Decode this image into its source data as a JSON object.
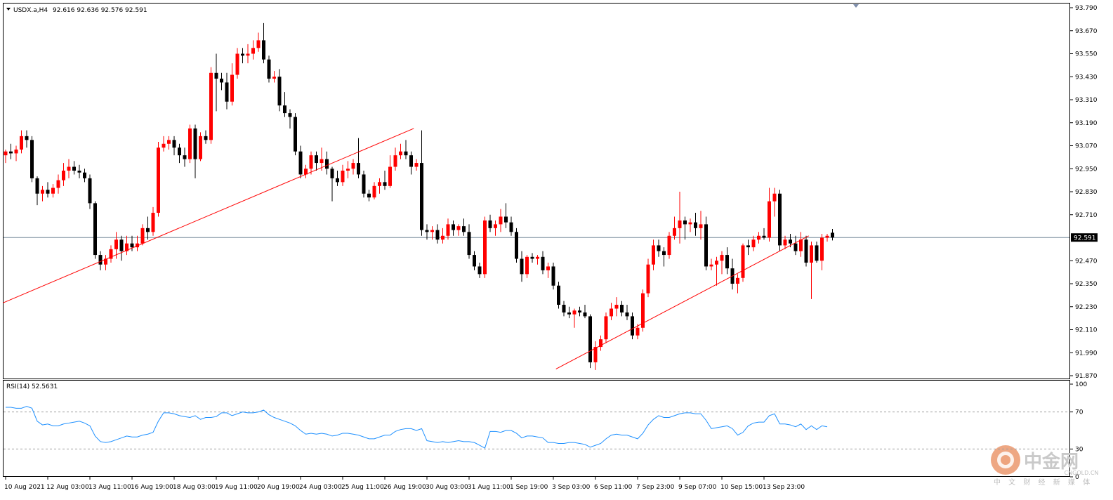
{
  "header": {
    "symbol": "USDX.a,H4",
    "ohlc": "92.616 92.636 92.576 92.591"
  },
  "rsi_header": "RSI(14) 52.5631",
  "current_price_label": "92.591",
  "watermark": {
    "brand": "中金网",
    "domain": "CNGOLD.CN",
    "tagline": "中 文 财 经 新 媒 体"
  },
  "colors": {
    "bull": "#ff0000",
    "bear": "#000000",
    "trendline": "#ff0000",
    "rsi": "#1e90ff",
    "price_line": "#778899",
    "level_line": "#a0a0a0"
  },
  "chart_data": [
    {
      "type": "candlestick",
      "ylim": [
        91.87,
        93.79
      ],
      "yticks": [
        93.79,
        93.67,
        93.55,
        93.43,
        93.31,
        93.19,
        93.07,
        92.95,
        92.83,
        92.71,
        92.47,
        92.35,
        92.23,
        92.11,
        91.99,
        91.87
      ],
      "ytick_labels": [
        "93.790",
        "93.670",
        "93.550",
        "93.430",
        "93.310",
        "93.190",
        "93.070",
        "92.950",
        "92.830",
        "92.710",
        "92.470",
        "92.350",
        "92.230",
        "92.110",
        "91.990",
        "91.870"
      ],
      "xtick_labels": [
        "10 Aug 2021",
        "12 Aug 03:00",
        "13 Aug 11:00",
        "16 Aug 19:00",
        "18 Aug 03:00",
        "19 Aug 11:00",
        "20 Aug 19:00",
        "24 Aug 03:00",
        "25 Aug 11:00",
        "26 Aug 19:00",
        "30 Aug 03:00",
        "31 Aug 11:00",
        "1 Sep 19:00",
        "3 Sep 03:00",
        "6 Sep 11:00",
        "7 Sep 23:00",
        "9 Sep 07:00",
        "10 Sep 15:00",
        "13 Sep 23:00"
      ],
      "xtick_index": [
        0,
        8,
        16,
        24,
        32,
        40,
        48,
        56,
        64,
        72,
        80,
        88,
        96,
        104,
        112,
        120,
        128,
        136,
        144
      ],
      "current_price": 92.591,
      "ohlc": [
        [
          93.02,
          93.05,
          92.98,
          93.04
        ],
        [
          93.04,
          93.08,
          93.0,
          93.03
        ],
        [
          93.03,
          93.07,
          92.99,
          93.05
        ],
        [
          93.05,
          93.15,
          93.03,
          93.12
        ],
        [
          93.12,
          93.15,
          93.06,
          93.1
        ],
        [
          93.1,
          93.12,
          92.88,
          92.9
        ],
        [
          92.9,
          92.91,
          92.76,
          92.82
        ],
        [
          92.82,
          92.86,
          92.78,
          92.84
        ],
        [
          92.84,
          92.88,
          92.8,
          92.82
        ],
        [
          92.82,
          92.87,
          92.8,
          92.85
        ],
        [
          92.85,
          92.92,
          92.82,
          92.89
        ],
        [
          92.89,
          92.98,
          92.86,
          92.94
        ],
        [
          92.94,
          93.0,
          92.9,
          92.96
        ],
        [
          92.96,
          92.99,
          92.92,
          92.94
        ],
        [
          92.94,
          92.97,
          92.9,
          92.93
        ],
        [
          92.93,
          92.95,
          92.88,
          92.9
        ],
        [
          92.9,
          92.92,
          92.74,
          92.77
        ],
        [
          92.77,
          92.78,
          92.48,
          92.5
        ],
        [
          92.5,
          92.52,
          92.42,
          92.45
        ],
        [
          92.45,
          92.5,
          92.42,
          92.48
        ],
        [
          92.48,
          92.55,
          92.46,
          92.53
        ],
        [
          92.53,
          92.62,
          92.48,
          92.58
        ],
        [
          92.58,
          92.6,
          92.47,
          92.52
        ],
        [
          92.52,
          92.6,
          92.5,
          92.56
        ],
        [
          92.56,
          92.6,
          92.52,
          92.54
        ],
        [
          92.54,
          92.6,
          92.52,
          92.56
        ],
        [
          92.56,
          92.66,
          92.55,
          92.64
        ],
        [
          92.64,
          92.7,
          92.58,
          92.62
        ],
        [
          92.62,
          92.75,
          92.6,
          92.72
        ],
        [
          92.72,
          93.09,
          92.7,
          93.06
        ],
        [
          93.06,
          93.12,
          93.04,
          93.08
        ],
        [
          93.08,
          93.12,
          93.05,
          93.1
        ],
        [
          93.1,
          93.12,
          93.02,
          93.06
        ],
        [
          93.06,
          93.08,
          92.98,
          93.02
        ],
        [
          93.02,
          93.06,
          92.96,
          93.0
        ],
        [
          93.0,
          93.18,
          92.98,
          93.16
        ],
        [
          93.16,
          93.18,
          92.9,
          93.0
        ],
        [
          93.0,
          93.14,
          92.99,
          93.12
        ],
        [
          93.12,
          93.15,
          93.08,
          93.1
        ],
        [
          93.1,
          93.48,
          93.08,
          93.45
        ],
        [
          93.45,
          93.55,
          93.25,
          93.42
        ],
        [
          93.42,
          93.45,
          93.36,
          93.4
        ],
        [
          93.4,
          93.45,
          93.26,
          93.3
        ],
        [
          93.3,
          93.5,
          93.28,
          93.44
        ],
        [
          93.44,
          93.58,
          93.42,
          93.55
        ],
        [
          93.55,
          93.58,
          93.5,
          93.54
        ],
        [
          93.54,
          93.6,
          93.5,
          93.55
        ],
        [
          93.55,
          93.62,
          93.52,
          93.58
        ],
        [
          93.58,
          93.66,
          93.56,
          93.62
        ],
        [
          93.62,
          93.71,
          93.5,
          93.52
        ],
        [
          93.52,
          93.54,
          93.4,
          93.42
        ],
        [
          93.42,
          93.46,
          93.4,
          93.43
        ],
        [
          93.43,
          93.47,
          93.25,
          93.28
        ],
        [
          93.28,
          93.35,
          93.22,
          93.24
        ],
        [
          93.24,
          93.26,
          93.16,
          93.22
        ],
        [
          93.22,
          93.24,
          93.02,
          93.04
        ],
        [
          93.04,
          93.07,
          92.9,
          92.92
        ],
        [
          92.92,
          92.97,
          92.9,
          92.95
        ],
        [
          92.95,
          93.04,
          92.92,
          93.02
        ],
        [
          93.02,
          93.04,
          92.94,
          92.98
        ],
        [
          92.98,
          93.06,
          92.94,
          93.0
        ],
        [
          93.0,
          93.04,
          92.92,
          92.95
        ],
        [
          92.95,
          92.96,
          92.78,
          92.9
        ],
        [
          92.9,
          92.94,
          92.86,
          92.88
        ],
        [
          92.88,
          92.97,
          92.86,
          92.94
        ],
        [
          92.94,
          92.99,
          92.9,
          92.95
        ],
        [
          92.95,
          93.0,
          92.92,
          92.98
        ],
        [
          92.98,
          93.11,
          92.9,
          92.92
        ],
        [
          92.92,
          92.94,
          92.8,
          92.82
        ],
        [
          92.82,
          92.84,
          92.78,
          92.8
        ],
        [
          92.8,
          92.88,
          92.79,
          92.86
        ],
        [
          92.86,
          92.9,
          92.82,
          92.88
        ],
        [
          92.88,
          92.94,
          92.84,
          92.86
        ],
        [
          92.86,
          93.02,
          92.85,
          92.96
        ],
        [
          92.96,
          93.06,
          92.94,
          93.02
        ],
        [
          93.02,
          93.08,
          93.0,
          93.04
        ],
        [
          93.04,
          93.1,
          93.0,
          93.02
        ],
        [
          93.02,
          93.04,
          92.92,
          92.96
        ],
        [
          92.96,
          93.0,
          92.94,
          92.98
        ],
        [
          92.98,
          93.15,
          92.6,
          92.63
        ],
        [
          92.63,
          92.66,
          92.58,
          92.62
        ],
        [
          92.62,
          92.65,
          92.58,
          92.63
        ],
        [
          92.63,
          92.66,
          92.56,
          92.58
        ],
        [
          92.58,
          92.64,
          92.56,
          92.6
        ],
        [
          92.6,
          92.69,
          92.58,
          92.66
        ],
        [
          92.66,
          92.68,
          92.6,
          92.63
        ],
        [
          92.63,
          92.66,
          92.6,
          92.65
        ],
        [
          92.65,
          92.69,
          92.6,
          92.62
        ],
        [
          92.62,
          92.66,
          92.48,
          92.5
        ],
        [
          92.5,
          92.52,
          92.42,
          92.44
        ],
        [
          92.44,
          92.46,
          92.38,
          92.4
        ],
        [
          92.4,
          92.7,
          92.38,
          92.68
        ],
        [
          92.68,
          92.71,
          92.62,
          92.64
        ],
        [
          92.64,
          92.68,
          92.6,
          92.66
        ],
        [
          92.66,
          92.74,
          92.62,
          92.7
        ],
        [
          92.7,
          92.77,
          92.64,
          92.67
        ],
        [
          92.67,
          92.7,
          92.6,
          92.62
        ],
        [
          92.62,
          92.64,
          92.46,
          92.48
        ],
        [
          92.48,
          92.52,
          92.36,
          92.4
        ],
        [
          92.4,
          92.5,
          92.38,
          92.49
        ],
        [
          92.49,
          92.51,
          92.46,
          92.48
        ],
        [
          92.48,
          92.5,
          92.45,
          92.49
        ],
        [
          92.49,
          92.52,
          92.4,
          92.42
        ],
        [
          92.42,
          92.46,
          92.38,
          92.44
        ],
        [
          92.44,
          92.46,
          92.32,
          92.34
        ],
        [
          92.34,
          92.36,
          92.22,
          92.24
        ],
        [
          92.24,
          92.26,
          92.18,
          92.2
        ],
        [
          92.2,
          92.23,
          92.17,
          92.19
        ],
        [
          92.19,
          92.22,
          92.12,
          92.21
        ],
        [
          92.21,
          92.23,
          92.18,
          92.2
        ],
        [
          92.2,
          92.24,
          92.17,
          92.18
        ],
        [
          92.18,
          92.19,
          91.91,
          91.94
        ],
        [
          91.94,
          92.05,
          91.9,
          92.02
        ],
        [
          92.02,
          92.08,
          92.0,
          92.06
        ],
        [
          92.06,
          92.2,
          92.04,
          92.18
        ],
        [
          92.18,
          92.25,
          92.16,
          92.22
        ],
        [
          92.22,
          92.28,
          92.18,
          92.24
        ],
        [
          92.24,
          92.26,
          92.18,
          92.2
        ],
        [
          92.2,
          92.24,
          92.16,
          92.18
        ],
        [
          92.18,
          92.2,
          92.06,
          92.08
        ],
        [
          92.08,
          92.14,
          92.06,
          92.12
        ],
        [
          92.12,
          92.32,
          92.1,
          92.3
        ],
        [
          92.3,
          92.48,
          92.28,
          92.45
        ],
        [
          92.45,
          92.58,
          92.42,
          92.55
        ],
        [
          92.55,
          92.58,
          92.49,
          92.52
        ],
        [
          92.52,
          92.54,
          92.44,
          92.5
        ],
        [
          92.5,
          92.62,
          92.48,
          92.6
        ],
        [
          92.6,
          92.7,
          92.58,
          92.64
        ],
        [
          92.64,
          92.83,
          92.56,
          92.68
        ],
        [
          92.68,
          92.7,
          92.58,
          92.66
        ],
        [
          92.66,
          92.69,
          92.62,
          92.67
        ],
        [
          92.67,
          92.72,
          92.6,
          92.64
        ],
        [
          92.64,
          92.73,
          92.58,
          92.66
        ],
        [
          92.66,
          92.7,
          92.42,
          92.44
        ],
        [
          92.44,
          92.48,
          92.42,
          92.45
        ],
        [
          92.45,
          92.49,
          92.34,
          92.47
        ],
        [
          92.47,
          92.52,
          92.4,
          92.5
        ],
        [
          92.5,
          92.54,
          92.4,
          92.43
        ],
        [
          92.43,
          92.48,
          92.32,
          92.35
        ],
        [
          92.35,
          92.4,
          92.3,
          92.38
        ],
        [
          92.38,
          92.56,
          92.36,
          92.55
        ],
        [
          92.55,
          92.58,
          92.5,
          92.54
        ],
        [
          92.54,
          92.6,
          92.52,
          92.58
        ],
        [
          92.58,
          92.62,
          92.56,
          92.6
        ],
        [
          92.6,
          92.64,
          92.58,
          92.59
        ],
        [
          92.59,
          92.85,
          92.57,
          92.78
        ],
        [
          92.78,
          92.85,
          92.7,
          92.82
        ],
        [
          92.82,
          92.84,
          92.52,
          92.55
        ],
        [
          92.55,
          92.6,
          92.53,
          92.58
        ],
        [
          92.58,
          92.61,
          92.54,
          92.56
        ],
        [
          92.56,
          92.6,
          92.5,
          92.52
        ],
        [
          92.52,
          92.62,
          92.49,
          92.58
        ],
        [
          92.58,
          92.6,
          92.44,
          92.46
        ],
        [
          92.46,
          92.57,
          92.27,
          92.55
        ],
        [
          92.55,
          92.57,
          92.46,
          92.47
        ],
        [
          92.47,
          92.61,
          92.42,
          92.59
        ],
        [
          92.59,
          92.61,
          92.57,
          92.6
        ],
        [
          92.616,
          92.636,
          92.576,
          92.591
        ]
      ],
      "trendlines": [
        {
          "x1": -0.5,
          "y1": 92.25,
          "x2": 77.5,
          "y2": 93.16
        },
        {
          "x1": 104.5,
          "y1": 91.905,
          "x2": 152.5,
          "y2": 92.6
        }
      ]
    },
    {
      "type": "line",
      "name": "RSI(14)",
      "ylim": [
        0,
        100
      ],
      "yticks": [
        100,
        70,
        30,
        0
      ],
      "ytick_labels": [
        "100",
        "70",
        "30",
        "0"
      ],
      "levels": [
        70,
        30
      ],
      "series": [
        {
          "values": [
            75,
            75,
            74,
            74,
            76,
            74,
            60,
            56,
            57,
            55,
            55,
            57,
            58,
            59,
            60,
            58,
            55,
            44,
            38,
            37,
            38,
            40,
            42,
            44,
            43,
            43,
            45,
            46,
            48,
            60,
            69,
            69,
            68,
            66,
            65,
            64,
            66,
            62,
            64,
            64,
            65,
            69,
            69,
            66,
            68,
            70,
            69,
            69,
            70,
            72,
            67,
            64,
            62,
            60,
            58,
            55,
            50,
            46,
            47,
            46,
            47,
            46,
            44,
            45,
            47,
            47,
            46,
            45,
            43,
            41,
            41,
            43,
            45,
            45,
            49,
            51,
            52,
            52,
            50,
            52,
            39,
            38,
            37,
            38,
            37,
            38,
            39,
            38,
            38,
            37,
            34,
            31,
            49,
            49,
            48,
            50,
            50,
            47,
            42,
            44,
            44,
            43,
            42,
            37,
            37,
            36,
            36,
            37,
            37,
            36,
            35,
            32,
            34,
            36,
            41,
            45,
            46,
            45,
            45,
            43,
            41,
            47,
            56,
            62,
            66,
            64,
            64,
            66,
            68,
            69,
            69,
            68,
            68,
            61,
            52,
            53,
            54,
            55,
            52,
            45,
            48,
            55,
            58,
            59,
            59,
            66,
            68,
            57,
            57,
            56,
            54,
            57,
            51,
            55,
            51,
            55,
            54
          ]
        }
      ]
    }
  ]
}
